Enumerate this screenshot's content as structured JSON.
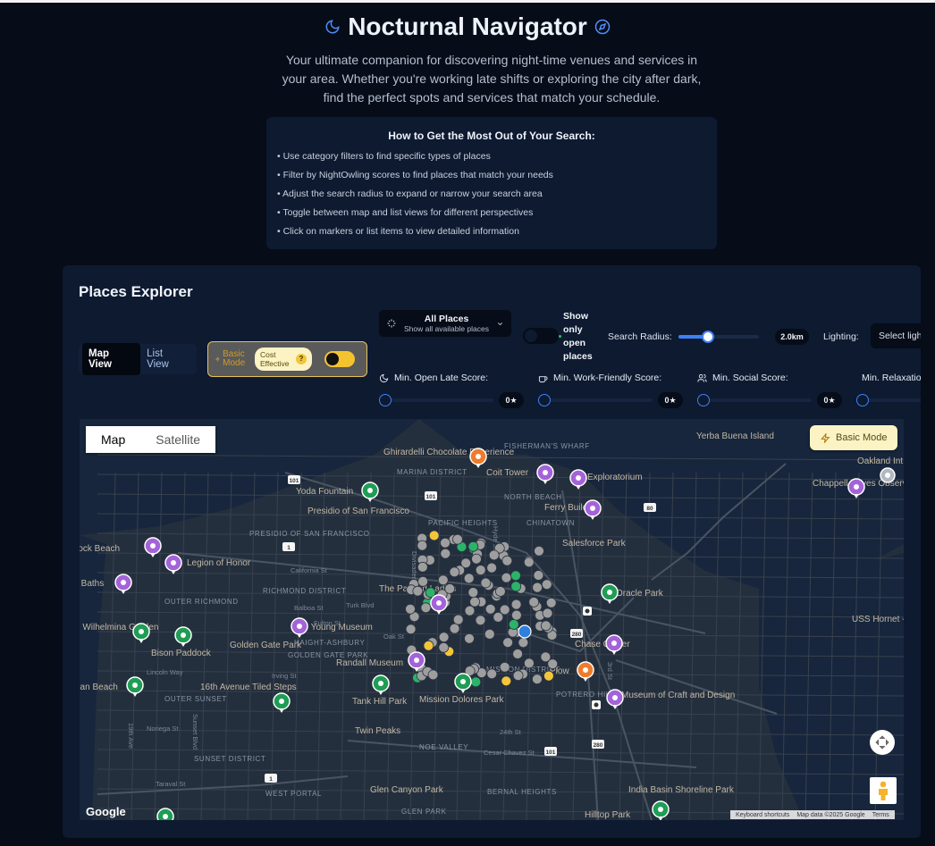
{
  "app": {
    "title": "Nocturnal Navigator",
    "subtitle": "Your ultimate companion for discovering night-time venues and services in your area. Whether you're working late shifts or exploring the city after dark, find the perfect spots and services that match your schedule.",
    "accent": "#3b82f6"
  },
  "howto": {
    "heading": "How to Get the Most Out of Your Search:",
    "tips": [
      "Use category filters to find specific types of places",
      "Filter by NightOwling scores to find places that match your needs",
      "Adjust the search radius to expand or narrow your search area",
      "Toggle between map and list views for different perspectives",
      "Click on markers or list items to view detailed information"
    ]
  },
  "explorer": {
    "title": "Places Explorer",
    "views": {
      "map": "Map View",
      "list": "List View",
      "active": "map"
    },
    "mode": {
      "label": "Basic Mode",
      "cost_pill": "Cost Effective",
      "help": "?",
      "enabled": true
    },
    "category": {
      "title": "All Places",
      "description": "Show all available places"
    },
    "open_only": {
      "label": "Show only open places",
      "enabled": false
    },
    "radius": {
      "label": "Search Radius:",
      "value": "2.0km",
      "fraction": 0.3
    },
    "lighting": {
      "label": "Lighting:",
      "placeholder": "Select lighting"
    },
    "scores": [
      {
        "icon": "moon-icon",
        "label": "Min. Open Late Score:",
        "value": "0★"
      },
      {
        "icon": "coffee-icon",
        "label": "Min. Work-Friendly Score:",
        "value": "0★"
      },
      {
        "icon": "users-icon",
        "label": "Min. Social Score:",
        "value": "0★"
      },
      {
        "icon": "star-icon",
        "label": "Min. Relaxation"
      }
    ]
  },
  "map": {
    "tabs": [
      "Map",
      "Satellite"
    ],
    "active_tab": "Map",
    "mode_badge": "Basic Mode",
    "logo": "Google",
    "attribution": [
      "Keyboard shortcuts",
      "Map data ©2025 Google",
      "Terms"
    ],
    "labels": [
      "Ghirardelli Chocolate Experience",
      "FISHERMAN'S WHARF",
      "MARINA DISTRICT",
      "Coit Tower",
      "Exploratorium",
      "Yerba Buena Island",
      "Chappell Hayes Observation Tower",
      "Oakland Int Container Termin",
      "Yoda Fountain",
      "Presidio of San Francisco",
      "NORTH BEACH",
      "Ferry Building",
      "CHINATOWN",
      "PACIFIC HEIGHTS",
      "PRESIDIO OF SAN FRANCISCO",
      "Salesforce Park",
      "Mile Rock Beach",
      "Legion of Honor",
      "Oracle Park",
      "ro Baths",
      "RICHMOND DISTRICT",
      "The Painted Ladies",
      "OUTER RICHMOND",
      "n Wilhelmina Garden",
      "de Young Museum",
      "Golden Gate Park",
      "GOLDEN GATE PARK",
      "HAIGHT-ASHBURY",
      "Chase Center",
      "USS Hornet - and Space M",
      "Bison Paddock",
      "Randall Museum",
      "Plow",
      "ean Beach",
      "16th Avenue Tiled Steps",
      "OUTER SUNSET",
      "MISSION DISTRICT",
      "POTRERO HILL",
      "Museum of Craft and Design",
      "Tank Hill Park",
      "Mission Dolores Park",
      "Twin Peaks",
      "NOE VALLEY",
      "SUNSET DISTRICT",
      "WEST PORTAL",
      "Glen Canyon Park",
      "BERNAL HEIGHTS",
      "GLEN PARK",
      "India Basin Shoreline Park",
      "Hilltop Park",
      "California St",
      "Balboa St",
      "Fulton St",
      "Lincoln Way",
      "Irving St",
      "Noriega St",
      "Taraval St",
      "Turk Blvd",
      "Oak St",
      "Cesar Chavez St",
      "24th St",
      "Divisadero St",
      "Hyde St",
      "Sunset Blvd",
      "19th Ave",
      "3rd St"
    ],
    "shields": [
      "101",
      "101",
      "1",
      "80",
      "280",
      "1",
      "280",
      "101"
    ],
    "colors": {
      "background": "#242f3e",
      "water": "#17263c",
      "road": "#38414e",
      "cluster_gray": "#9e9e9e",
      "open_green": "#2bb368",
      "featured_yellow": "#f3c53a",
      "museum_purple": "#a463d8",
      "park_green": "#1f9d55",
      "food_orange": "#ef7b2c"
    },
    "poi_markers": [
      {
        "name": "Ghirardelli Chocolate Experience",
        "kind": "food"
      },
      {
        "name": "Coit Tower",
        "kind": "landmark"
      },
      {
        "name": "Exploratorium",
        "kind": "museum"
      },
      {
        "name": "Yoda Fountain",
        "kind": "park"
      },
      {
        "name": "Ferry Building",
        "kind": "landmark"
      },
      {
        "name": "Chappell Hayes Observation Tower",
        "kind": "landmark"
      },
      {
        "name": "Mile Rock Beach",
        "kind": "beach"
      },
      {
        "name": "Legion of Honor",
        "kind": "museum"
      },
      {
        "name": "Sutro Baths",
        "kind": "landmark"
      },
      {
        "name": "The Painted Ladies",
        "kind": "landmark"
      },
      {
        "name": "Oracle Park",
        "kind": "park"
      },
      {
        "name": "de Young Museum",
        "kind": "museum"
      },
      {
        "name": "Queen Wilhelmina Garden",
        "kind": "park"
      },
      {
        "name": "Bison Paddock",
        "kind": "park"
      },
      {
        "name": "Chase Center",
        "kind": "landmark"
      },
      {
        "name": "Randall Museum",
        "kind": "museum"
      },
      {
        "name": "Plow",
        "kind": "food"
      },
      {
        "name": "Ocean Beach",
        "kind": "park"
      },
      {
        "name": "16th Avenue Tiled Steps",
        "kind": "park"
      },
      {
        "name": "Tank Hill Park",
        "kind": "park"
      },
      {
        "name": "Mission Dolores Park",
        "kind": "park"
      },
      {
        "name": "Museum of Craft and Design",
        "kind": "museum"
      },
      {
        "name": "Hilltop Park",
        "kind": "park"
      },
      {
        "name": "India Basin Shoreline Park",
        "kind": "park"
      }
    ]
  }
}
